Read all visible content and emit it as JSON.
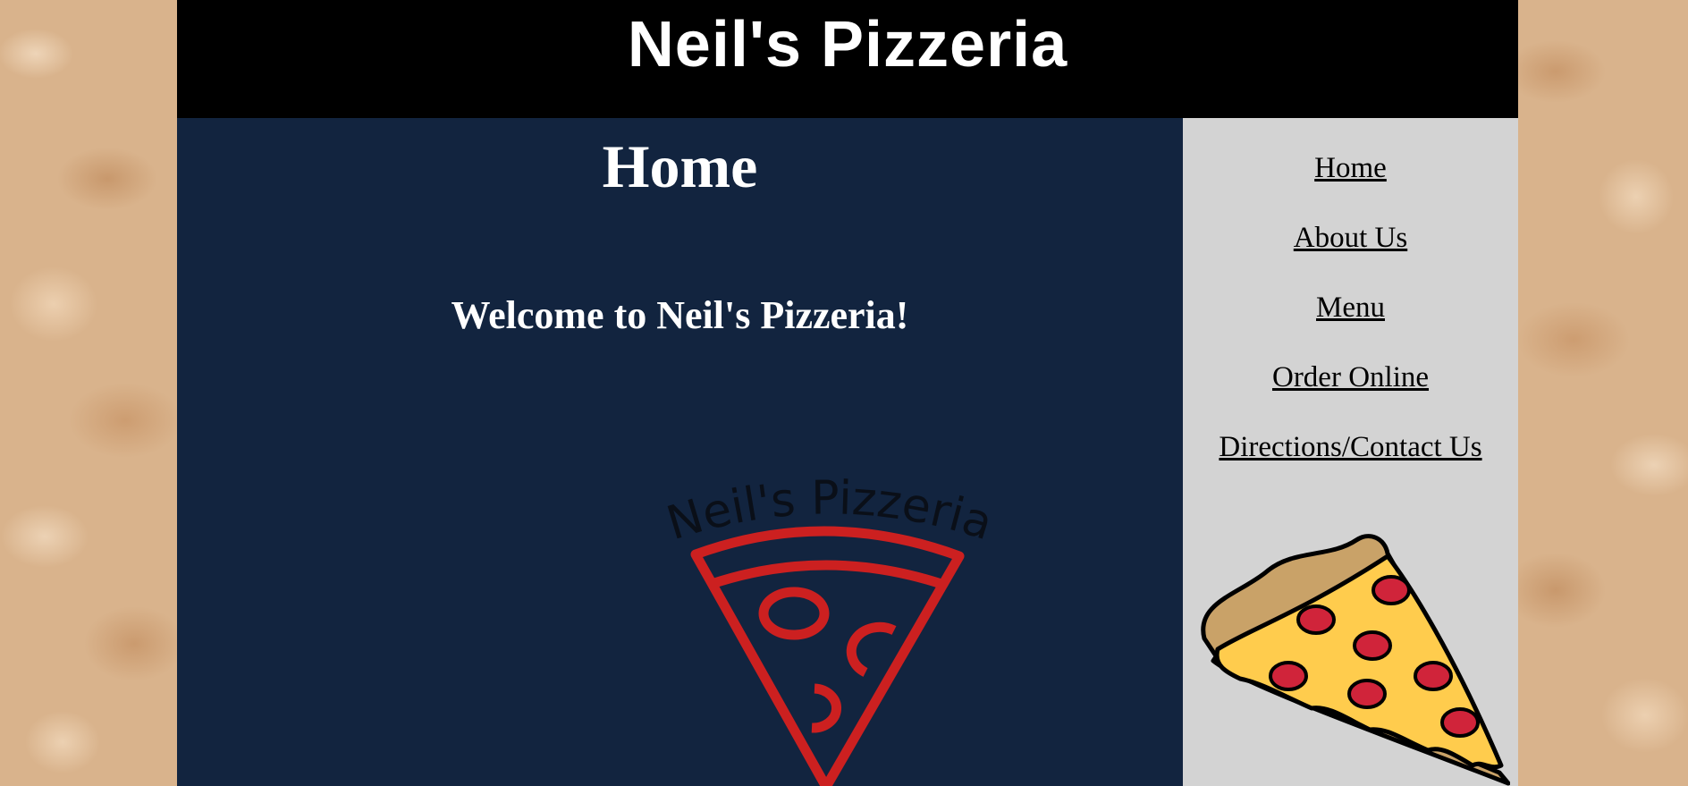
{
  "header": {
    "title": "Neil's Pizzeria"
  },
  "main": {
    "heading": "Home",
    "welcome": "Welcome to Neil's Pizzeria!",
    "logo": {
      "text": "Neil's Pizzeria",
      "icon": "pizza-slice-outline-icon"
    }
  },
  "nav": {
    "items": [
      {
        "label": "Home"
      },
      {
        "label": "About Us"
      },
      {
        "label": "Menu"
      },
      {
        "label": "Order Online"
      },
      {
        "label": "Directions/Contact Us"
      }
    ]
  },
  "sidebar": {
    "image_icon": "pepperoni-pizza-slice-icon"
  },
  "colors": {
    "header_bg": "#000000",
    "main_bg": "#12243f",
    "sidebar_bg": "#d3d3d3",
    "logo_red": "#cc2020",
    "cheese": "#ffcc4d",
    "pepperoni": "#d0243a"
  }
}
